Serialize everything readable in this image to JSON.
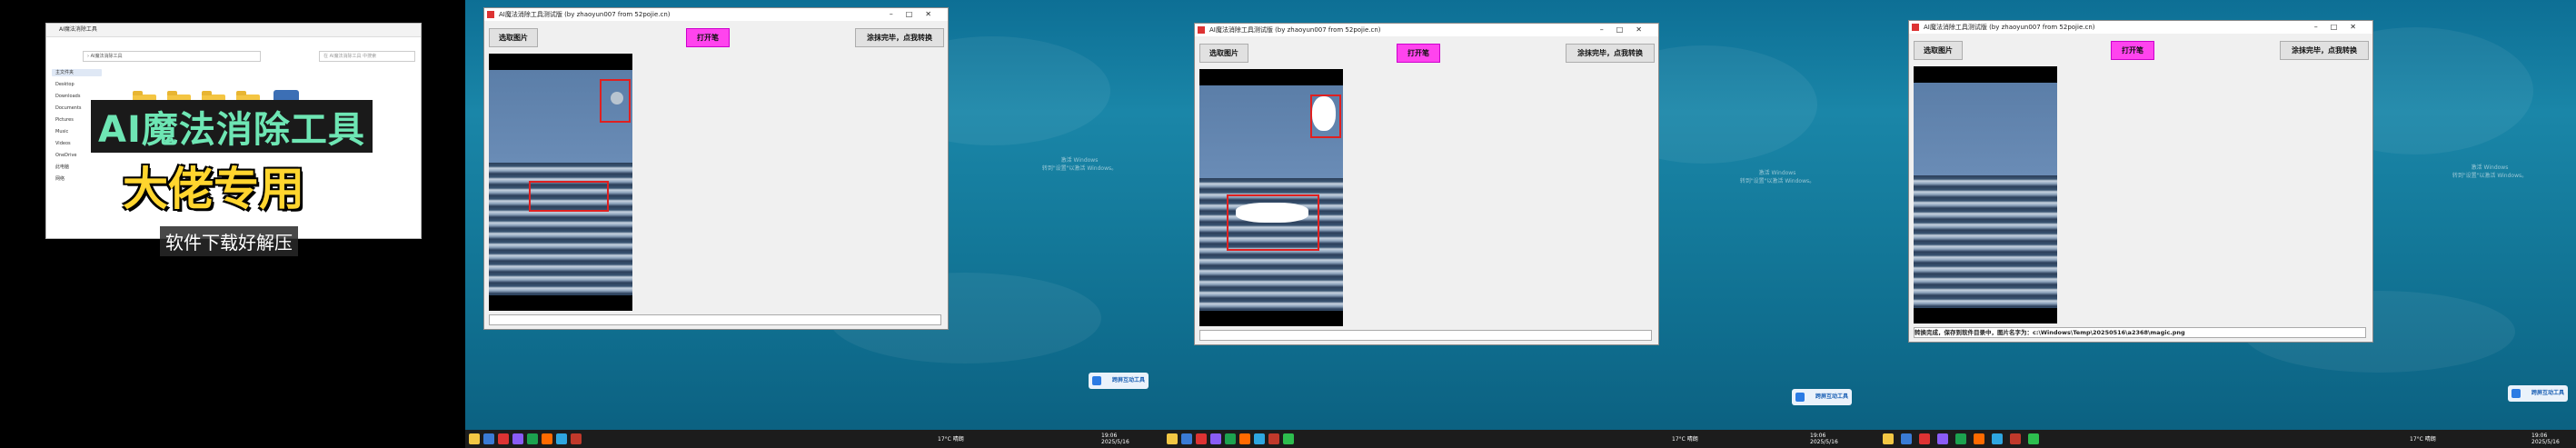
{
  "panel1": {
    "explorer_title": "AI魔法消除工具",
    "address": "› AI魔法消除工具",
    "search_placeholder": "在 AI魔法消除工具 中搜索",
    "nav_items": [
      "主文件夹",
      "Desktop",
      "Downloads",
      "Documents",
      "Pictures",
      "Music",
      "Videos",
      "OneDrive",
      "此电脑",
      "网络"
    ],
    "headline": "AI魔法消除工具",
    "subheadline": "大佬专用",
    "caption": "软件下载好解压"
  },
  "app": {
    "window_title": "AI魔法消除工具测试版 (by zhaoyun007 from 52pojie.cn)",
    "select_label": "选取图片",
    "eraser_label": "打开笔",
    "convert_label": "涂抹完毕，点我转换",
    "result_status": "转换完成，保存到软件目录中，图片名字为：c:\\Windows\\Temp\\20250516\\a2368\\magic.png"
  },
  "desktop": {
    "watermark_line1": "激活 Windows",
    "watermark_line2": "转到\"设置\"以激活 Windows。",
    "tray_label": "跨屏互动工具",
    "weather": "17°C 晴朗",
    "time": "19:06",
    "date": "2025/5/16"
  },
  "colors": {
    "pink_button": "#ff44ee",
    "highlight_red": "#e02020",
    "headline_green": "#6ee6b4",
    "subheadline_yellow": "#ffd52e"
  }
}
